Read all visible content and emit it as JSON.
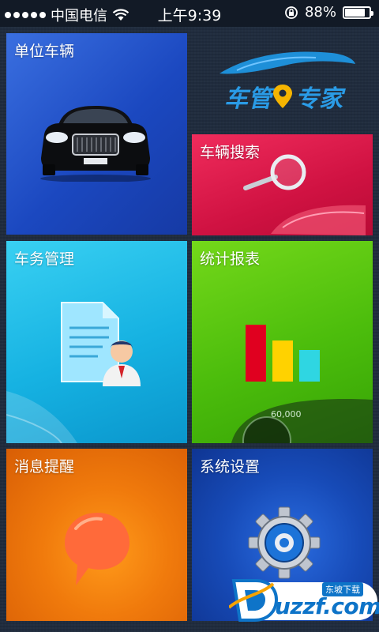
{
  "status_bar": {
    "carrier": "中国电信",
    "time": "上午9:39",
    "battery_text": "88%",
    "battery_level": 0.88
  },
  "logo": {
    "text_left": "车管",
    "text_right": "专家"
  },
  "tiles": {
    "vehicles": {
      "label": "单位车辆"
    },
    "search": {
      "label": "车辆搜索"
    },
    "affairs": {
      "label": "车务管理"
    },
    "reports": {
      "label": "统计报表"
    },
    "messages": {
      "label": "消息提醒"
    },
    "settings": {
      "label": "系统设置"
    }
  },
  "dashboard_text": "60,000",
  "watermark": {
    "brand": "uzzf.com",
    "sub": "东坡下载"
  },
  "colors": {
    "vehicles": "#1b48c0",
    "search": "#d01242",
    "affairs": "#16b2e2",
    "reports": "#4cbd0c",
    "messages": "#f07a0c",
    "settings": "#174bb8"
  }
}
